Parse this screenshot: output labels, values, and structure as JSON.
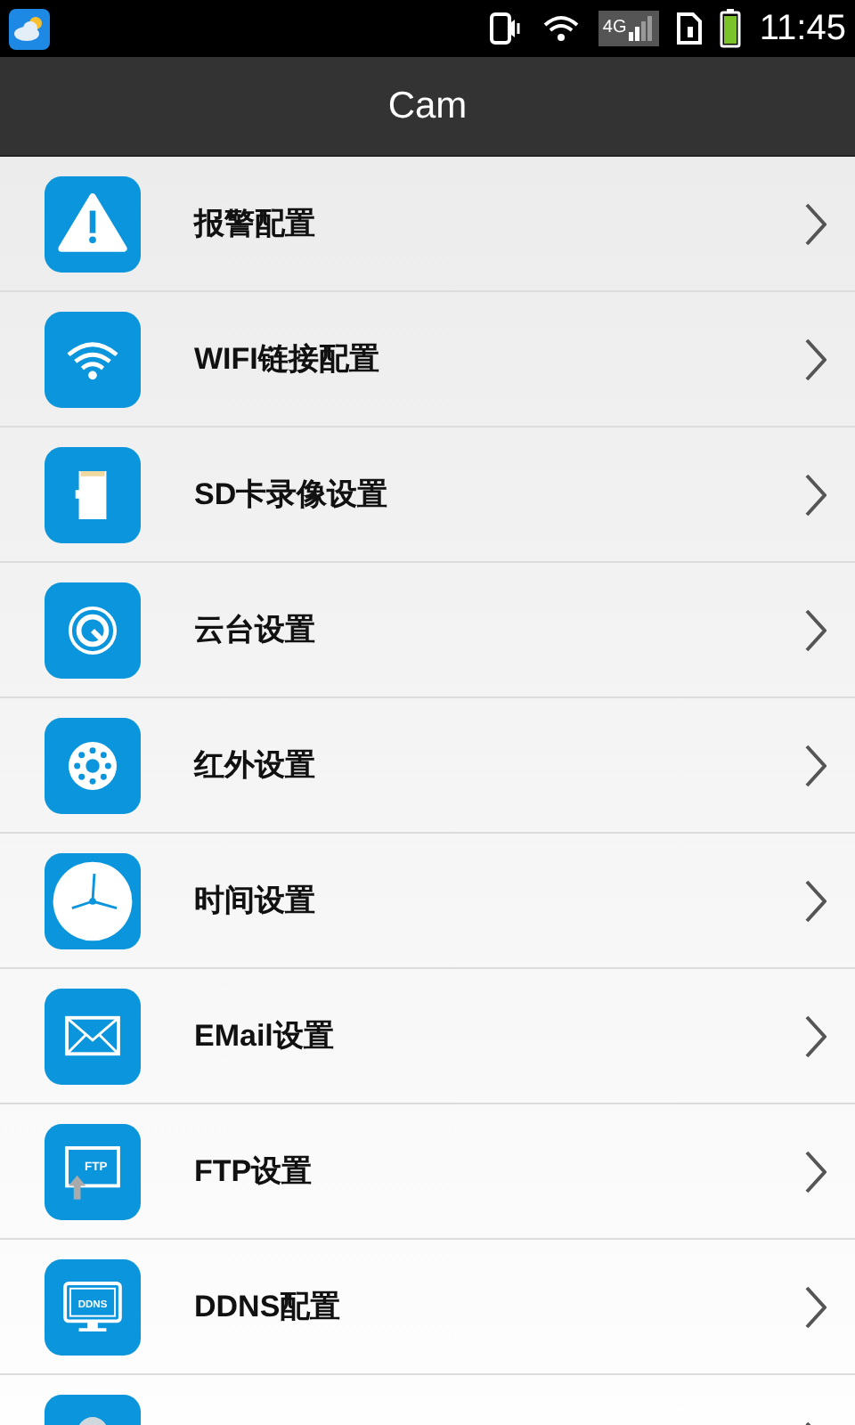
{
  "status_bar": {
    "network": "4G",
    "time": "11:45"
  },
  "title": "Cam",
  "items": [
    {
      "kind": "alert",
      "label": "报警配置"
    },
    {
      "kind": "wifi",
      "label": "WIFI链接配置"
    },
    {
      "kind": "sd",
      "label": "SD卡录像设置"
    },
    {
      "kind": "ptz",
      "label": "云台设置"
    },
    {
      "kind": "infrared",
      "label": "红外设置"
    },
    {
      "kind": "clock",
      "label": "时间设置"
    },
    {
      "kind": "mail",
      "label": "EMail设置"
    },
    {
      "kind": "ftp",
      "label": "FTP设置",
      "icon_text": "FTP"
    },
    {
      "kind": "ddns",
      "label": "DDNS配置",
      "icon_text": "DDNS"
    },
    {
      "kind": "user"
    }
  ]
}
